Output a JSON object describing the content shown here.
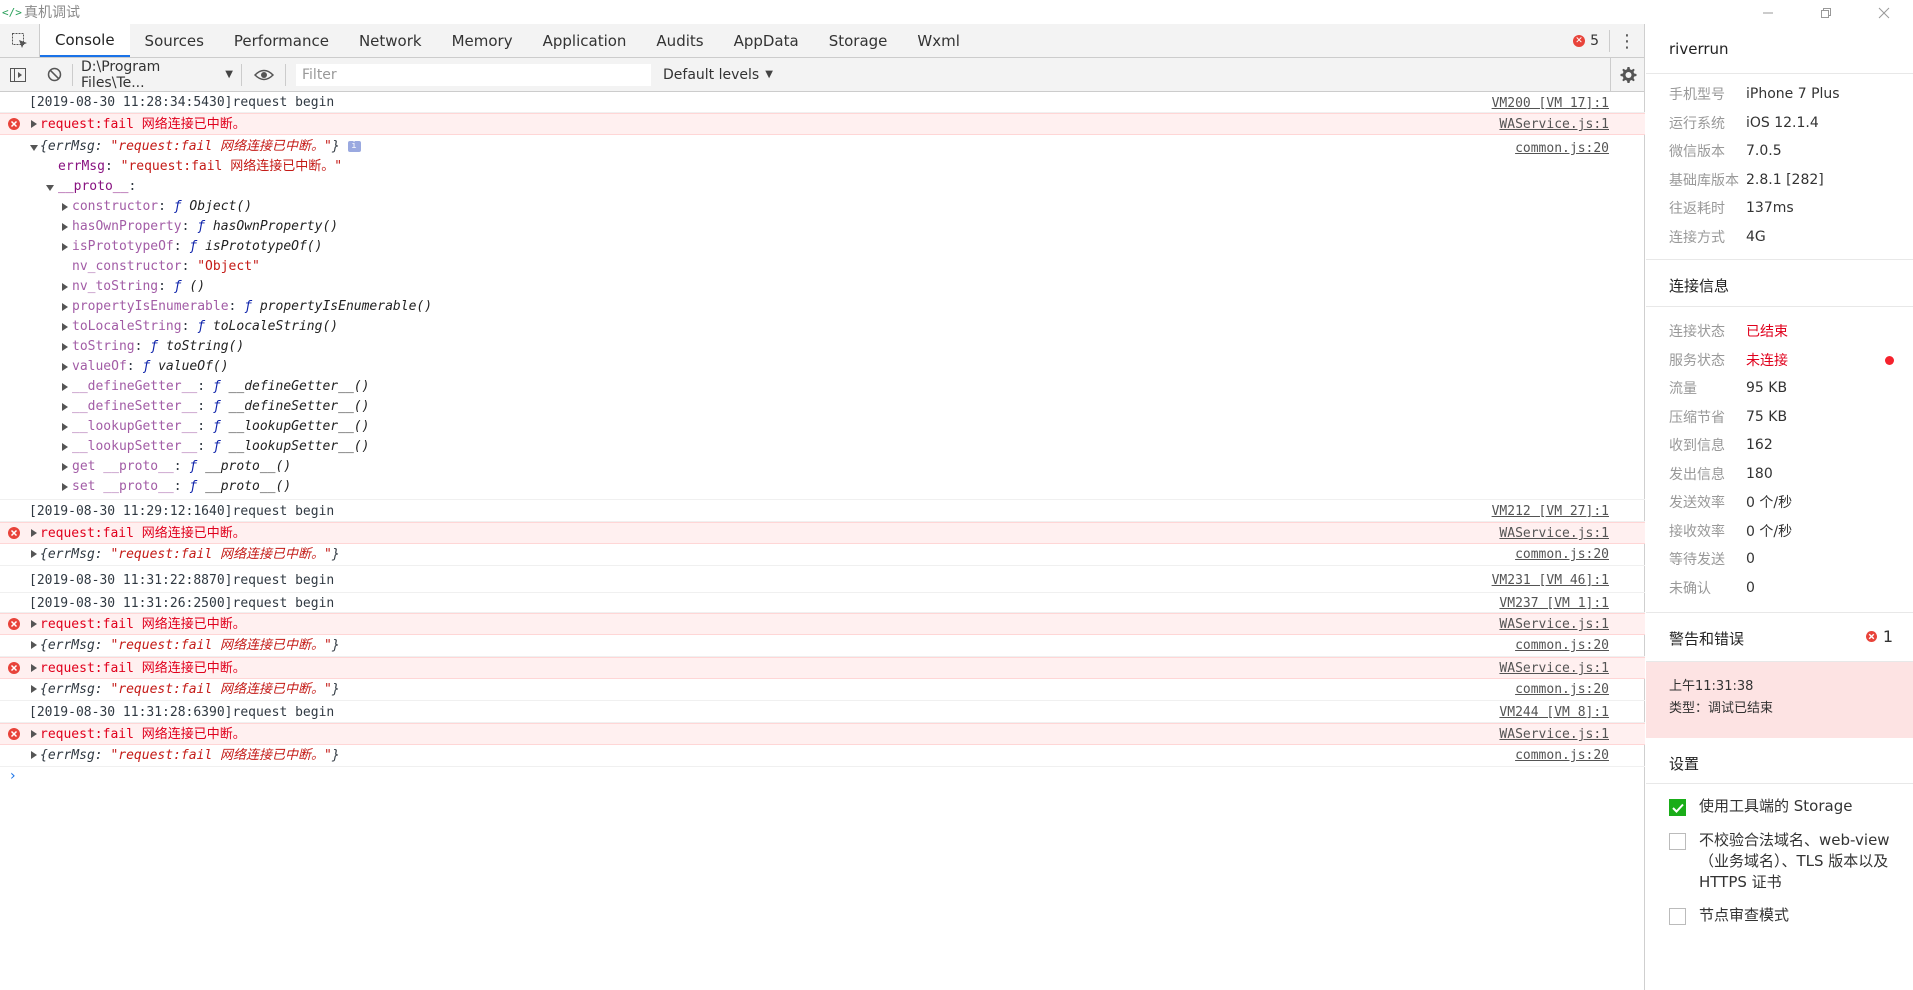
{
  "window": {
    "title": "真机调试",
    "app_icon": "code-brackets-icon"
  },
  "tabs": [
    {
      "label": "Console",
      "active": true
    },
    {
      "label": "Sources"
    },
    {
      "label": "Performance"
    },
    {
      "label": "Network"
    },
    {
      "label": "Memory"
    },
    {
      "label": "Application"
    },
    {
      "label": "Audits"
    },
    {
      "label": "AppData"
    },
    {
      "label": "Storage"
    },
    {
      "label": "Wxml"
    }
  ],
  "error_count": "5",
  "toolbar": {
    "context": "D:\\Program Files\\Te...",
    "filter_placeholder": "Filter",
    "levels": "Default levels"
  },
  "console": {
    "log1": {
      "text": "[2019-08-30 11:28:34:5430]request begin",
      "src": "VM200 [VM 17]:1"
    },
    "err1": {
      "text": "request:fail 网络连接已中断。",
      "src": "WAService.js:1"
    },
    "obj1": {
      "head_open": "{errMsg: ",
      "head_val": "\"request:fail 网络连接已中断。\"",
      "head_close": "}",
      "badge": "i",
      "src": "common.js:20",
      "errmsg_key": "errMsg",
      "errmsg_val": "\"request:fail 网络连接已中断。\"",
      "proto_key": "__proto__",
      "props": [
        {
          "key": "constructor",
          "val": "Object()"
        },
        {
          "key": "hasOwnProperty",
          "val": "hasOwnProperty()"
        },
        {
          "key": "isPrototypeOf",
          "val": "isPrototypeOf()"
        },
        {
          "key": "nv_constructor",
          "val": "\"Object\""
        },
        {
          "key": "nv_toString",
          "val": "()"
        },
        {
          "key": "propertyIsEnumerable",
          "val": "propertyIsEnumerable()"
        },
        {
          "key": "toLocaleString",
          "val": "toLocaleString()"
        },
        {
          "key": "toString",
          "val": "toString()"
        },
        {
          "key": "valueOf",
          "val": "valueOf()"
        },
        {
          "key": "__defineGetter__",
          "val": "__defineGetter__()"
        },
        {
          "key": "__defineSetter__",
          "val": "__defineSetter__()"
        },
        {
          "key": "__lookupGetter__",
          "val": "__lookupGetter__()"
        },
        {
          "key": "__lookupSetter__",
          "val": "__lookupSetter__()"
        },
        {
          "key": "get __proto__",
          "val": "__proto__()"
        },
        {
          "key": "set __proto__",
          "val": "__proto__()"
        }
      ],
      "func_symbol": "ƒ"
    },
    "log2": {
      "text": "[2019-08-30 11:29:12:1640]request begin",
      "src": "VM212 [VM 27]:1"
    },
    "err2": {
      "text": "request:fail 网络连接已中断。",
      "src": "WAService.js:1"
    },
    "obj2": {
      "open": "{errMsg: ",
      "val": "\"request:fail 网络连接已中断。\"",
      "close": "}",
      "src": "common.js:20"
    },
    "log3": {
      "text": "[2019-08-30 11:31:22:8870]request begin",
      "src": "VM231 [VM 46]:1"
    },
    "log4": {
      "text": "[2019-08-30 11:31:26:2500]request begin",
      "src": "VM237 [VM 1]:1"
    },
    "err3": {
      "text": "request:fail 网络连接已中断。",
      "src": "WAService.js:1"
    },
    "obj3": {
      "open": "{errMsg: ",
      "val": "\"request:fail 网络连接已中断。\"",
      "close": "}",
      "src": "common.js:20"
    },
    "err4": {
      "text": "request:fail 网络连接已中断。",
      "src": "WAService.js:1"
    },
    "obj4": {
      "open": "{errMsg: ",
      "val": "\"request:fail 网络连接已中断。\"",
      "close": "}",
      "src": "common.js:20"
    },
    "log5": {
      "text": "[2019-08-30 11:31:28:6390]request begin",
      "src": "VM244 [VM 8]:1"
    },
    "err5": {
      "text": "request:fail 网络连接已中断。",
      "src": "WAService.js:1"
    },
    "obj5": {
      "open": "{errMsg: ",
      "val": "\"request:fail 网络连接已中断。\"",
      "close": "}",
      "src": "common.js:20"
    },
    "prompt": "›"
  },
  "panel": {
    "user": "riverrun",
    "device": [
      {
        "k": "手机型号",
        "v": "iPhone 7 Plus"
      },
      {
        "k": "运行系统",
        "v": "iOS 12.1.4"
      },
      {
        "k": "微信版本",
        "v": "7.0.5"
      },
      {
        "k": "基础库版本",
        "v": "2.8.1 [282]"
      },
      {
        "k": "往返耗时",
        "v": "137ms"
      },
      {
        "k": "连接方式",
        "v": "4G"
      }
    ],
    "conn_title": "连接信息",
    "conn": [
      {
        "k": "连接状态",
        "v": "已结束"
      },
      {
        "k": "服务状态",
        "v": "未连接"
      },
      {
        "k": "流量",
        "v": "95 KB"
      },
      {
        "k": "压缩节省",
        "v": "75 KB"
      },
      {
        "k": "收到信息",
        "v": "162"
      },
      {
        "k": "发出信息",
        "v": "180"
      },
      {
        "k": "发送效率",
        "v": "0 个/秒"
      },
      {
        "k": "接收效率",
        "v": "0 个/秒"
      },
      {
        "k": "等待发送",
        "v": "0"
      },
      {
        "k": "未确认",
        "v": "0"
      }
    ],
    "warn_title": "警告和错误",
    "warn_count": "1",
    "warn_time": "上午11:31:38",
    "warn_type": "类型：调试已结束",
    "settings_title": "设置",
    "settings": [
      {
        "label": "使用工具端的 Storage",
        "checked": true
      },
      {
        "label": "不校验合法域名、web-view（业务域名）、TLS 版本以及 HTTPS 证书",
        "checked": false
      },
      {
        "label": "节点审查模式",
        "checked": false
      }
    ],
    "colors": {
      "red": "#e0001c",
      "green": "#1aad19",
      "warn_bg": "#fde3e3"
    }
  }
}
